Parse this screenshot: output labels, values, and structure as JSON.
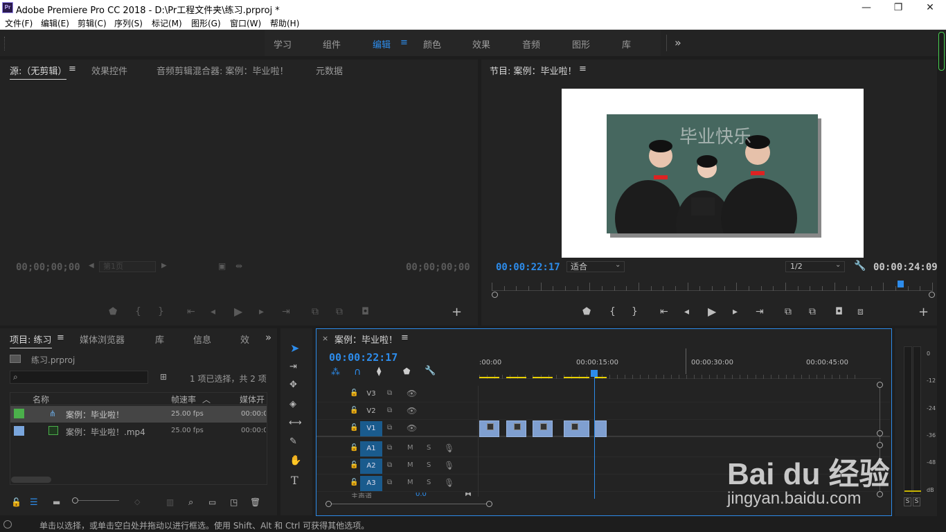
{
  "title": "Adobe Premiere Pro CC 2018 - D:\\Pr工程文件夹\\练习.prproj *",
  "app_icon": "Pr",
  "window": {
    "minimize": "—",
    "maximize": "❐",
    "close": "✕"
  },
  "menu": [
    "文件(F)",
    "编辑(E)",
    "剪辑(C)",
    "序列(S)",
    "标记(M)",
    "图形(G)",
    "窗口(W)",
    "帮助(H)"
  ],
  "workspaces": {
    "items": [
      "学习",
      "组件",
      "编辑",
      "颜色",
      "效果",
      "音频",
      "图形",
      "库"
    ],
    "active": "编辑",
    "more": "»"
  },
  "source_panel": {
    "tabs": [
      "源:（无剪辑）",
      "效果控件",
      "音频剪辑混合器: 案例：毕业啦！",
      "元数据"
    ],
    "tc_left": "00;00;00;00",
    "tc_right": "00;00;00;00",
    "page": "第1页"
  },
  "program_panel": {
    "tab": "节目: 案例：毕业啦！",
    "timecode": "00:00:22:17",
    "fit": "适合",
    "resolution": "1/2",
    "duration": "00:00:24:09",
    "playhead_fraction": 0.927,
    "frame_text": "毕业快乐"
  },
  "project_panel": {
    "tabs": [
      "项目: 练习",
      "媒体浏览器",
      "库",
      "信息",
      "效"
    ],
    "more": "»",
    "file": "练习.prproj",
    "selection_info": "1 项已选择，共 2 项",
    "columns": [
      "名称",
      "帧速率",
      "媒体开"
    ],
    "rows": [
      {
        "color": "#4bb04b",
        "name": "案例：毕业啦！",
        "fps": "25.00 fps",
        "start": "00:00:0",
        "selected": true
      },
      {
        "color": "#7aa6dd",
        "name": "案例：毕业啦！.mp4",
        "fps": "25.00 fps",
        "start": "00:00:0",
        "selected": false
      }
    ]
  },
  "timeline": {
    "close": "×",
    "tab": "案例：毕业啦！",
    "timecode": "00:00:22:17",
    "ruler": [
      ":00:00",
      "00:00:15:00",
      "00:00:30:00",
      "00:00:45:00"
    ],
    "tracks_video": [
      "V3",
      "V2",
      "V1"
    ],
    "tracks_audio": [
      "A1",
      "A2",
      "A3"
    ],
    "master": "主声道",
    "master_value": "0.0",
    "clips_start_sec": [
      0,
      3.5,
      7,
      11,
      15
    ],
    "playhead_sec": 15.0
  },
  "meter": {
    "labels": [
      "0",
      "-12",
      "-24",
      "-36",
      "-48",
      "dB"
    ],
    "solo": [
      "S",
      "S"
    ]
  },
  "statusbar": "单击以选择，或单击空白处并拖动以进行框选。使用 Shift、Alt 和 Ctrl 可获得其他选项。",
  "watermark": {
    "logo": "Bai du 经验",
    "url": "jingyan.baidu.com"
  },
  "colors": {
    "accent": "#2d8ceb",
    "track_on": "#1a5b8d",
    "clip": "#7f9fd0",
    "marker": "#e8d000"
  }
}
